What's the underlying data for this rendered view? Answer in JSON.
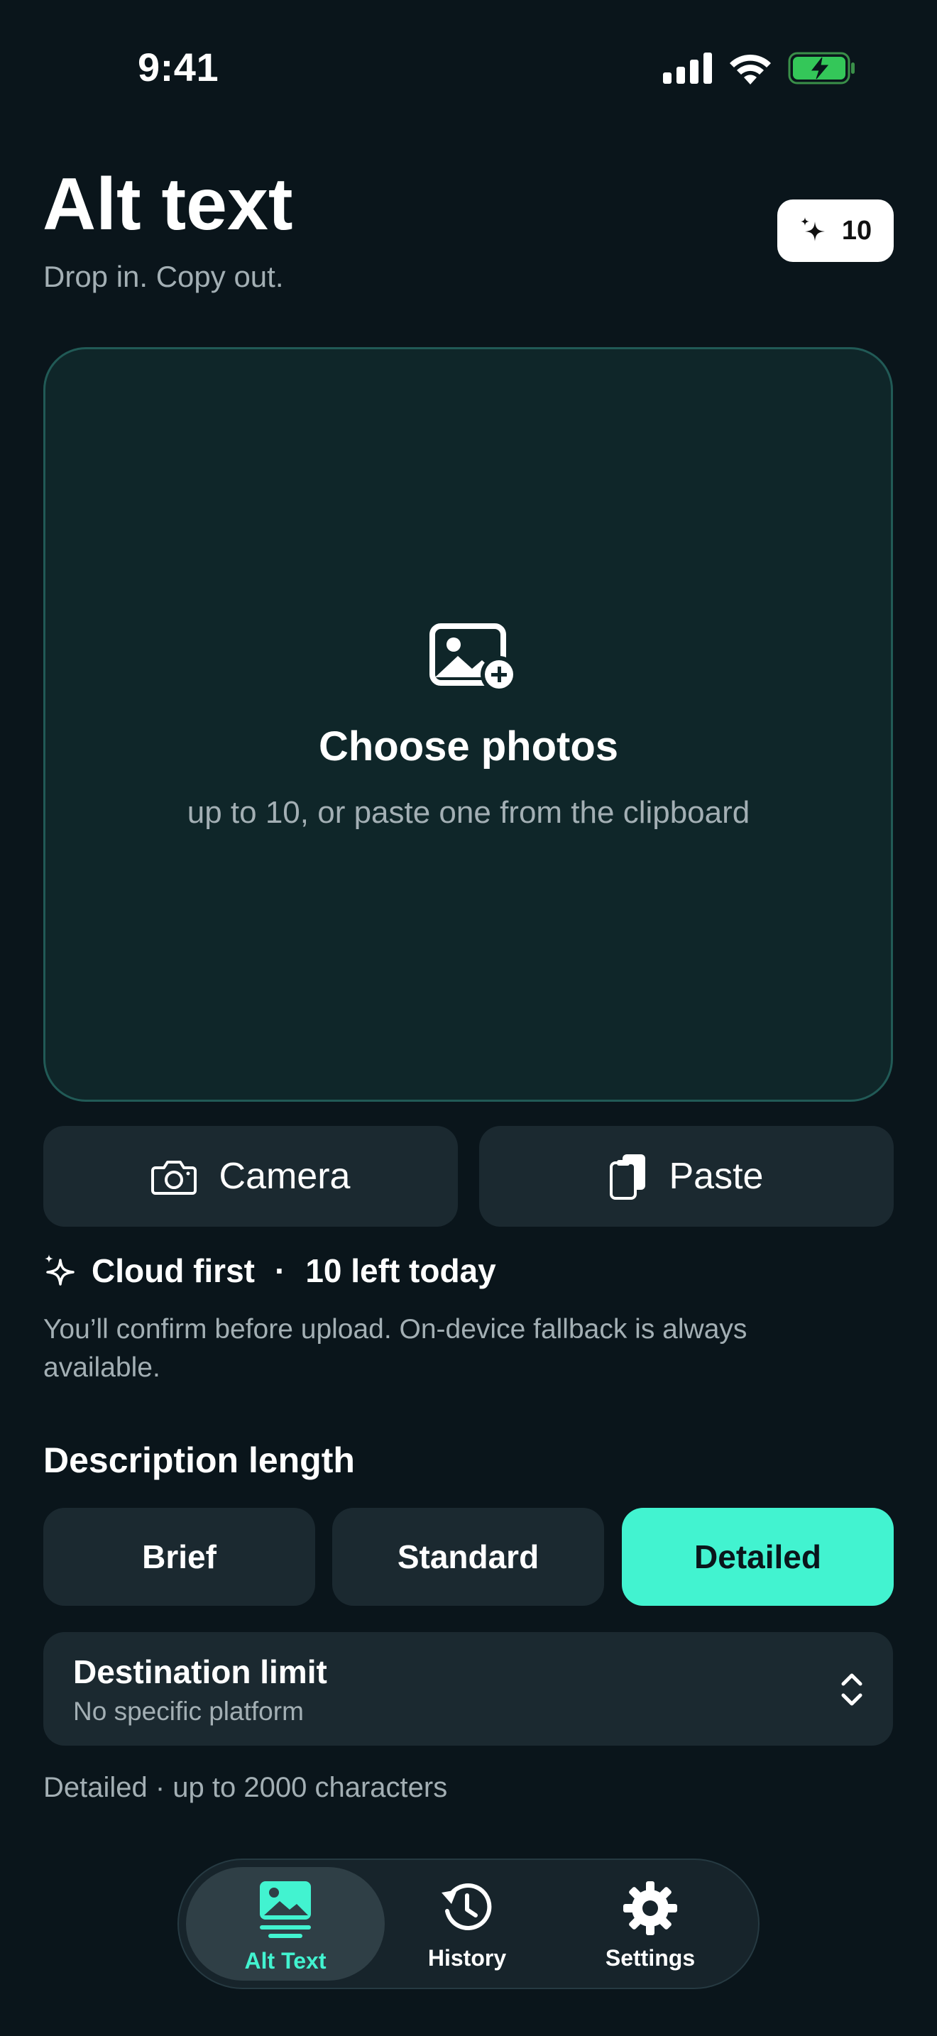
{
  "status_bar": {
    "time": "9:41",
    "icons": [
      "signal-icon",
      "wifi-icon",
      "battery-charging-icon"
    ]
  },
  "header": {
    "title": "Alt text",
    "subtitle": "Drop in. Copy out.",
    "credits_badge": {
      "icon": "sparkle-icon",
      "count": "10"
    }
  },
  "dropzone": {
    "icon": "photo-add-icon",
    "title": "Choose photos",
    "subtitle": "up to 10, or paste one from the clipboard"
  },
  "actions": {
    "camera_label": "Camera",
    "paste_label": "Paste"
  },
  "cloud": {
    "mode": "Cloud first",
    "separator": "·",
    "remaining": "10 left today",
    "note": "You’ll confirm before upload. On-device fallback is always available."
  },
  "description_length": {
    "title": "Description length",
    "options": [
      "Brief",
      "Standard",
      "Detailed"
    ],
    "selected": "Detailed"
  },
  "destination": {
    "title": "Destination limit",
    "value": "No specific platform"
  },
  "summary": "Detailed · up to 2000 characters",
  "tabbar": {
    "tabs": [
      {
        "label": "Alt Text",
        "icon": "image-text-icon",
        "active": true
      },
      {
        "label": "History",
        "icon": "history-icon",
        "active": false
      },
      {
        "label": "Settings",
        "icon": "gear-icon",
        "active": false
      }
    ]
  },
  "colors": {
    "background": "#0a151b",
    "accent": "#42f3d0",
    "card": "#1b2930",
    "dropzone_border": "#215a56"
  }
}
